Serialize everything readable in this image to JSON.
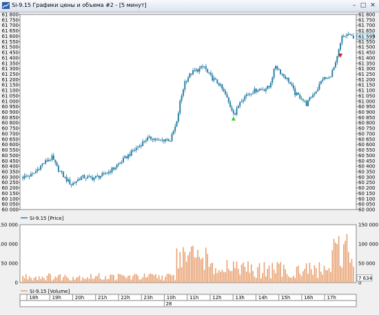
{
  "window": {
    "title": "Si-9.15 Графики цены и объема #2 - [5 минут]",
    "controls": {
      "minimize": "–",
      "maximize": "□",
      "close": "✕"
    }
  },
  "colors": {
    "candle": "#2a7fa6",
    "volume": "#e8a070",
    "up_arrow": "#33cc33",
    "down_arrow": "#cc2222",
    "price_marker": "#d8f0f8"
  },
  "price_panel": {
    "legend": "Si-9.15 [Price]",
    "last_price": "61 595"
  },
  "volume_panel": {
    "legend": "Si-9.15 [Volume]",
    "last_volume": "7 634"
  },
  "time_axis": {
    "hours": [
      "18h",
      "19h",
      "20h",
      "21h",
      "22h",
      "23h",
      "10h",
      "11h",
      "12h",
      "13h",
      "14h",
      "15h",
      "16h",
      "17h"
    ],
    "date": "28"
  },
  "chart_data": [
    {
      "type": "candlestick",
      "title": "Si-9.15 [Price]",
      "ylim": [
        60000,
        61800
      ],
      "yticks": [
        61800,
        61750,
        61700,
        61650,
        61600,
        61550,
        61500,
        61450,
        61400,
        61350,
        61300,
        61250,
        61200,
        61150,
        61100,
        61050,
        61000,
        60950,
        60900,
        60850,
        60800,
        60750,
        60700,
        60650,
        60600,
        60550,
        60500,
        60450,
        60400,
        60350,
        60300,
        60250,
        60200,
        60150,
        60100,
        60050,
        60000
      ],
      "close_path": [
        [
          0,
          60300
        ],
        [
          6,
          60320
        ],
        [
          12,
          60420
        ],
        [
          18,
          60480
        ],
        [
          21,
          60390
        ],
        [
          26,
          60290
        ],
        [
          30,
          60230
        ],
        [
          36,
          60300
        ],
        [
          43,
          60290
        ],
        [
          50,
          60320
        ],
        [
          56,
          60380
        ],
        [
          62,
          60460
        ],
        [
          68,
          60540
        ],
        [
          72,
          60590
        ],
        [
          76,
          60650
        ],
        [
          80,
          60660
        ],
        [
          84,
          60630
        ],
        [
          88,
          60650
        ],
        [
          91,
          60640
        ],
        [
          95,
          60800
        ],
        [
          97,
          60990
        ],
        [
          100,
          61180
        ],
        [
          104,
          61260
        ],
        [
          108,
          61290
        ],
        [
          112,
          61320
        ],
        [
          114,
          61260
        ],
        [
          117,
          61210
        ],
        [
          121,
          61160
        ],
        [
          125,
          61060
        ],
        [
          128,
          60950
        ],
        [
          131,
          60880
        ],
        [
          134,
          61000
        ],
        [
          138,
          61060
        ],
        [
          142,
          61090
        ],
        [
          145,
          61110
        ],
        [
          149,
          61110
        ],
        [
          152,
          61130
        ],
        [
          156,
          61330
        ],
        [
          160,
          61250
        ],
        [
          164,
          61190
        ],
        [
          168,
          61070
        ],
        [
          172,
          61030
        ],
        [
          175,
          60970
        ],
        [
          178,
          61040
        ],
        [
          182,
          61120
        ],
        [
          185,
          61210
        ],
        [
          189,
          61210
        ],
        [
          193,
          61340
        ],
        [
          197,
          61590
        ],
        [
          201,
          61620
        ],
        [
          202,
          61595
        ]
      ],
      "volume_ylim": [
        0,
        150000
      ],
      "volume_yticks": [
        150000,
        100000,
        50000,
        0
      ],
      "volume_labels": [
        "150 000",
        "100 000",
        "50 000",
        "0"
      ],
      "markers": [
        {
          "type": "buy-arrow",
          "x_index": 130,
          "price": 60840
        },
        {
          "type": "sell-arrow",
          "x_index": 196,
          "price": 61420
        }
      ]
    }
  ]
}
